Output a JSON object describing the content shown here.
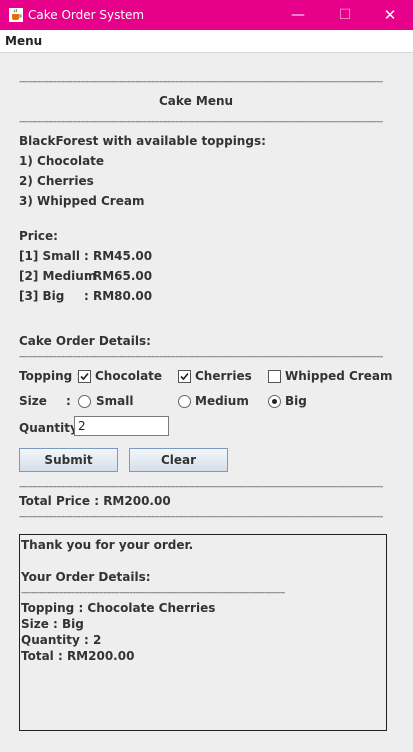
{
  "window": {
    "title": "Cake Order System",
    "minimize": "—",
    "maximize": "☐",
    "close": "✕"
  },
  "menubar": {
    "menu_label": "Menu"
  },
  "dash_line": "----------------------------------------------------------------------------------------------------------------------------------------------------------------",
  "dash_line_short": "------------------------------------------------------------------------------------------------------------------",
  "menu_section": {
    "title": "Cake Menu",
    "cake_heading": "BlackForest with available toppings:",
    "toppings": [
      "1) Chocolate",
      "2) Cherries",
      "3) Whipped Cream"
    ],
    "price_heading": "Price:",
    "prices": [
      {
        "code": "[1] Small",
        "value": ": RM45.00"
      },
      {
        "code": "[2] Medium",
        "value": ": RM65.00"
      },
      {
        "code": "[3] Big",
        "value": ": RM80.00"
      }
    ]
  },
  "order": {
    "heading": "Cake Order Details:",
    "topping_label": "Topping :",
    "toppings": [
      {
        "label": "Chocolate",
        "checked": true
      },
      {
        "label": "Cherries",
        "checked": true
      },
      {
        "label": "Whipped Cream",
        "checked": false
      }
    ],
    "size_label": "Size",
    "size_colon": ":",
    "sizes": [
      {
        "label": "Small",
        "selected": false
      },
      {
        "label": "Medium",
        "selected": false
      },
      {
        "label": "Big",
        "selected": true
      }
    ],
    "quantity_label": "Quantity:",
    "quantity_value": "2",
    "submit_label": "Submit",
    "clear_label": "Clear",
    "total_price": "Total Price : RM200.00"
  },
  "receipt": {
    "thanks": "Thank you for your order.",
    "details_heading": "Your Order Details:",
    "topping": "Topping : Chocolate Cherries",
    "size": "Size : Big",
    "quantity": "Quantity : 2",
    "total": "Total : RM200.00"
  }
}
